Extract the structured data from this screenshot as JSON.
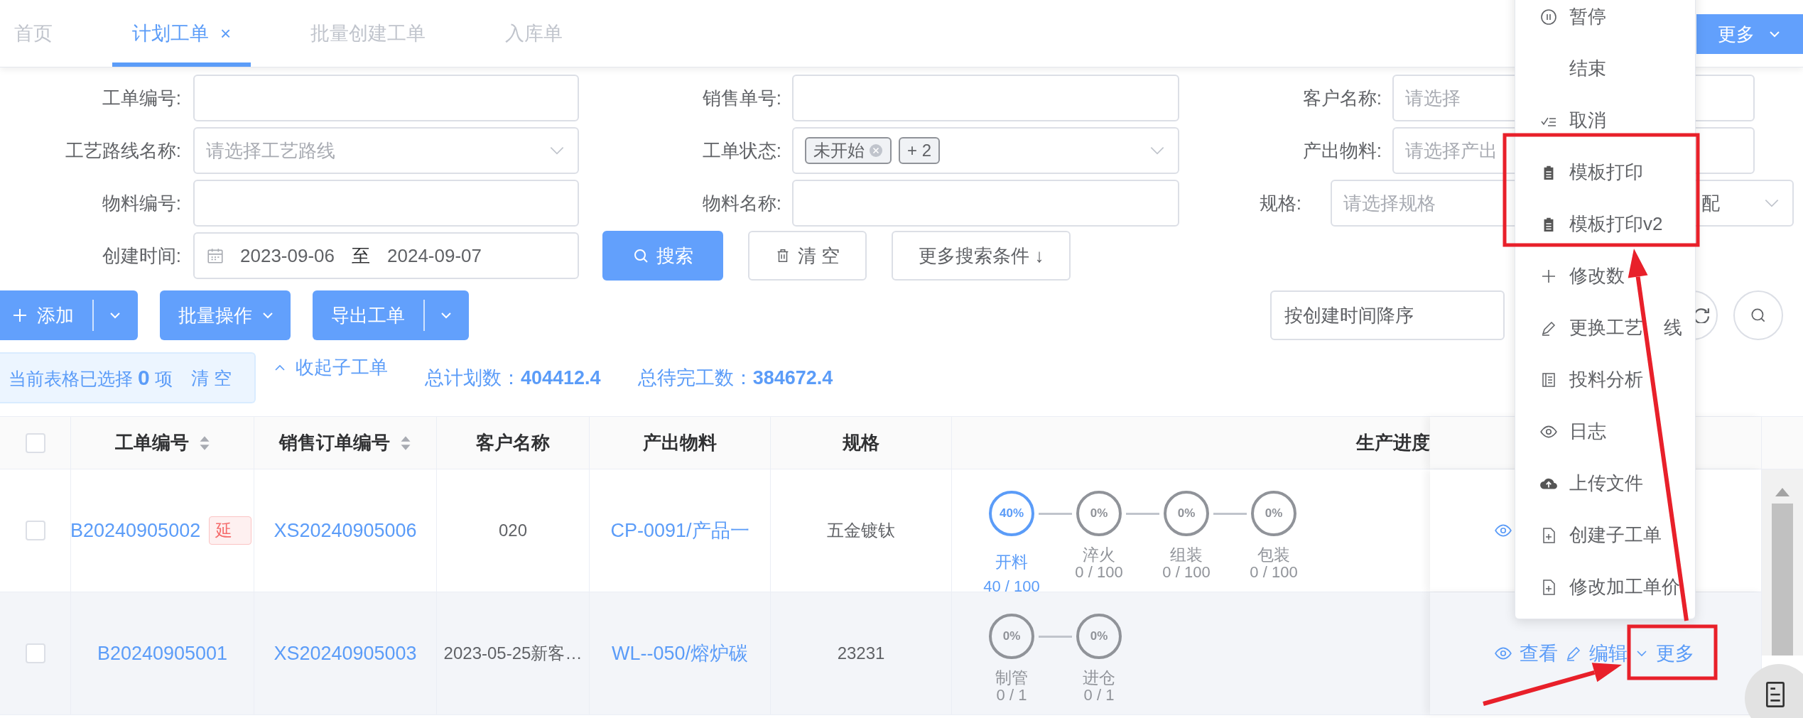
{
  "tabs": [
    {
      "label": "首页",
      "selected": false
    },
    {
      "label": "计划工单",
      "selected": true,
      "close_icon": "×"
    },
    {
      "label": "批量创建工单",
      "selected": false
    },
    {
      "label": "入库单",
      "selected": false
    }
  ],
  "header_button": {
    "label": "更多"
  },
  "filters": [
    [
      {
        "label": "工单编号:",
        "kind": "input"
      },
      {
        "label": "销售单号:",
        "kind": "input"
      },
      {
        "label": "客户名称:",
        "kind": "input",
        "placeholder": "请选择"
      }
    ],
    [
      {
        "label": "工艺路线名称:",
        "kind": "select",
        "placeholder": "请选择工艺路线"
      },
      {
        "label": "工单状态:",
        "kind": "tags",
        "tags": [
          "未开始"
        ],
        "more": "+ 2"
      },
      {
        "label": "产出物料:",
        "kind": "input",
        "placeholder": "请选择产出"
      }
    ],
    [
      {
        "label": "物料编号:",
        "kind": "input"
      },
      {
        "label": "物料名称:",
        "kind": "input"
      },
      {
        "label": "规格:",
        "kind": "select",
        "placeholder": "请选择规格",
        "value": "配"
      }
    ],
    [
      {
        "label": "创建时间:",
        "kind": "date",
        "start": "2023-09-06",
        "separator": "至",
        "end": "2024-09-07"
      }
    ]
  ],
  "filter_buttons": [
    {
      "label": "搜索",
      "kind": "primary"
    },
    {
      "label": "清 空",
      "kind": "plain"
    },
    {
      "label": "更多搜索条件 ↓",
      "kind": "plain"
    }
  ],
  "toolbar": [
    {
      "label": "添加",
      "kind": "split"
    },
    {
      "label": "批量操作",
      "kind": "dropdown"
    },
    {
      "label": "导出工单",
      "kind": "split"
    }
  ],
  "sort_select": {
    "value": "按创建时间降序"
  },
  "selection": {
    "text": "当前表格已选择 **0** 项",
    "clear": "清 空"
  },
  "collapse_link": "收起子工单",
  "stats": [
    {
      "label": "总计划数：",
      "value": "404412.4"
    },
    {
      "label": "总待完工数：",
      "value": "384672.4"
    }
  ],
  "table": {
    "all_checked": false,
    "columns": [
      {
        "label": "工单编号",
        "sortable": true
      },
      {
        "label": "销售订单编号",
        "sortable": true
      },
      {
        "label": "客户名称",
        "sortable": false
      },
      {
        "label": "产出物料",
        "sortable": false
      },
      {
        "label": "规格",
        "sortable": false
      },
      {
        "label": "生产进度",
        "sortable": false
      }
    ],
    "rows": [
      {
        "checked": false,
        "order_no": "B20240905002",
        "tag": "延",
        "sales_no": "XS20240905006",
        "customer": "020",
        "product": "CP-0091/产品一",
        "spec": "五金镀钛",
        "steps": [
          {
            "percent": "40%",
            "name": "开料",
            "count": "40 / 100",
            "active": true
          },
          {
            "percent": "0%",
            "name": "淬火",
            "count": "0 / 100",
            "active": false
          },
          {
            "percent": "0%",
            "name": "组装",
            "count": "0 / 100",
            "active": false
          },
          {
            "percent": "0%",
            "name": "包装",
            "count": "0 / 100",
            "active": false
          }
        ],
        "actions": [
          {
            "kind": "view"
          }
        ]
      },
      {
        "checked": false,
        "order_no": "B20240905001",
        "sales_no": "XS20240905003",
        "customer": "2023-05-25新客…",
        "product": "WL--050/熔炉碳",
        "spec": "23231",
        "steps": [
          {
            "percent": "0%",
            "name": "制管",
            "count": "0 / 1",
            "active": false
          },
          {
            "percent": "0%",
            "name": "进仓",
            "count": "0 / 1",
            "active": false
          }
        ],
        "actions": [
          {
            "kind": "view",
            "label": "查看"
          },
          {
            "kind": "edit",
            "label": "编辑"
          },
          {
            "kind": "more",
            "label": "更多"
          }
        ]
      }
    ]
  },
  "dropdown_menu": [
    {
      "label": "暂停"
    },
    {
      "label": "结束"
    },
    {
      "label": "取消"
    },
    {
      "label": "模板打印"
    },
    {
      "label": "模板打印v2"
    },
    {
      "label": "修改数"
    },
    {
      "label": "更换工艺",
      "label_tail": "线"
    },
    {
      "label": "投料分析"
    },
    {
      "label": "日志"
    },
    {
      "label": "上传文件"
    },
    {
      "label": "创建子工单"
    },
    {
      "label": "修改加工单价"
    }
  ]
}
